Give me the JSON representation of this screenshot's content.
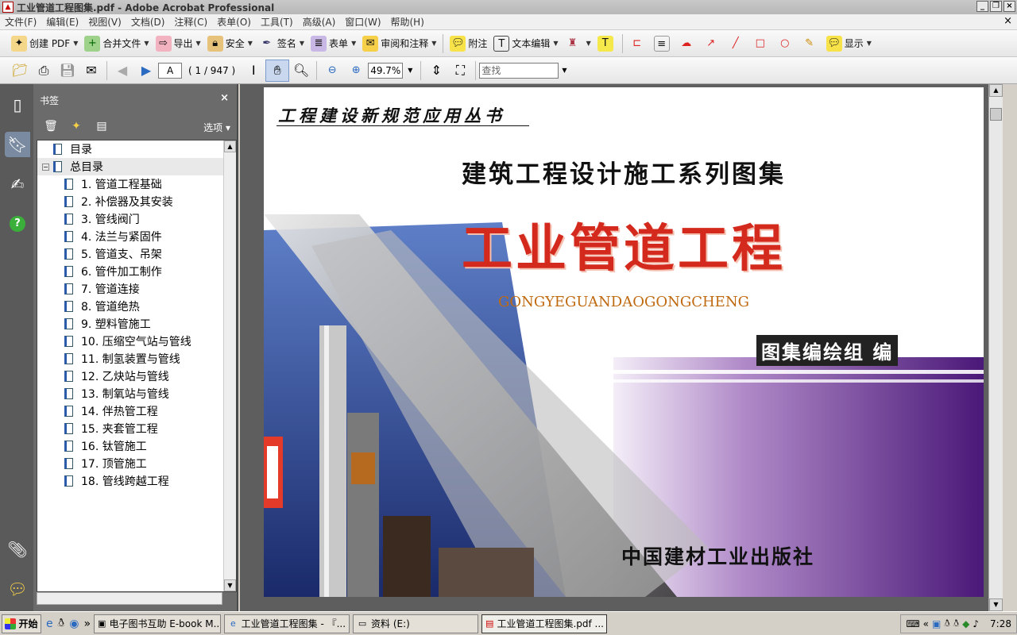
{
  "window": {
    "title": "工业管道工程图集.pdf - Adobe Acrobat Professional"
  },
  "menu": [
    "文件(F)",
    "编辑(E)",
    "视图(V)",
    "文档(D)",
    "注释(C)",
    "表单(O)",
    "工具(T)",
    "高级(A)",
    "窗口(W)",
    "帮助(H)"
  ],
  "toolbar1": {
    "create_pdf": "创建 PDF",
    "combine": "合并文件",
    "export": "导出",
    "security": "安全",
    "sign": "签名",
    "forms": "表单",
    "review": "审阅和注释",
    "note": "附注",
    "text_edit": "文本编辑",
    "show": "显示"
  },
  "toolbar2": {
    "page_input": "A",
    "page_count": "( 1 / 947 )",
    "zoom": "49.7%",
    "search_placeholder": "查找"
  },
  "bookmarks": {
    "title": "书签",
    "options": "选项",
    "items": [
      {
        "label": "目录",
        "level": 0
      },
      {
        "label": "总目录",
        "level": 0
      },
      {
        "label": "1.  管道工程基础",
        "level": 1
      },
      {
        "label": "2.  补偿器及其安装",
        "level": 1
      },
      {
        "label": "3.  管线阀门",
        "level": 1
      },
      {
        "label": "4.  法兰与紧固件",
        "level": 1
      },
      {
        "label": "5.  管道支、吊架",
        "level": 1
      },
      {
        "label": "6.  管件加工制作",
        "level": 1
      },
      {
        "label": "7.  管道连接",
        "level": 1
      },
      {
        "label": "8.  管道绝热",
        "level": 1
      },
      {
        "label": "9.  塑料管施工",
        "level": 1
      },
      {
        "label": "10.  压缩空气站与管线",
        "level": 1
      },
      {
        "label": "11.  制氢装置与管线",
        "level": 1
      },
      {
        "label": "12.  乙炔站与管线",
        "level": 1
      },
      {
        "label": "13.  制氧站与管线",
        "level": 1
      },
      {
        "label": "14.  伴热管工程",
        "level": 1
      },
      {
        "label": "15.  夹套管工程",
        "level": 1
      },
      {
        "label": "16.  钛管施工",
        "level": 1
      },
      {
        "label": "17.  顶管施工",
        "level": 1
      },
      {
        "label": "18.  管线跨越工程",
        "level": 1
      }
    ]
  },
  "cover": {
    "series": "工程建设新规范应用丛书",
    "subtitle": "建筑工程设计施工系列图集",
    "title": "工业管道工程",
    "pinyin": "GONGYEGUANDAOGONGCHENG",
    "editor": "图集编绘组 编",
    "publisher": "中国建材工业出版社"
  },
  "taskbar": {
    "start": "开始",
    "tasks": [
      "电子图书互助 E-book M...",
      "工业管道工程图集 - 『...",
      "资料 (E:)",
      "工业管道工程图集.pdf ..."
    ],
    "clock": "7:28"
  },
  "colors": {
    "title_red": "#d42a1e",
    "pinyin_orange": "#c06a10",
    "panel_gray": "#6b6b6b"
  }
}
